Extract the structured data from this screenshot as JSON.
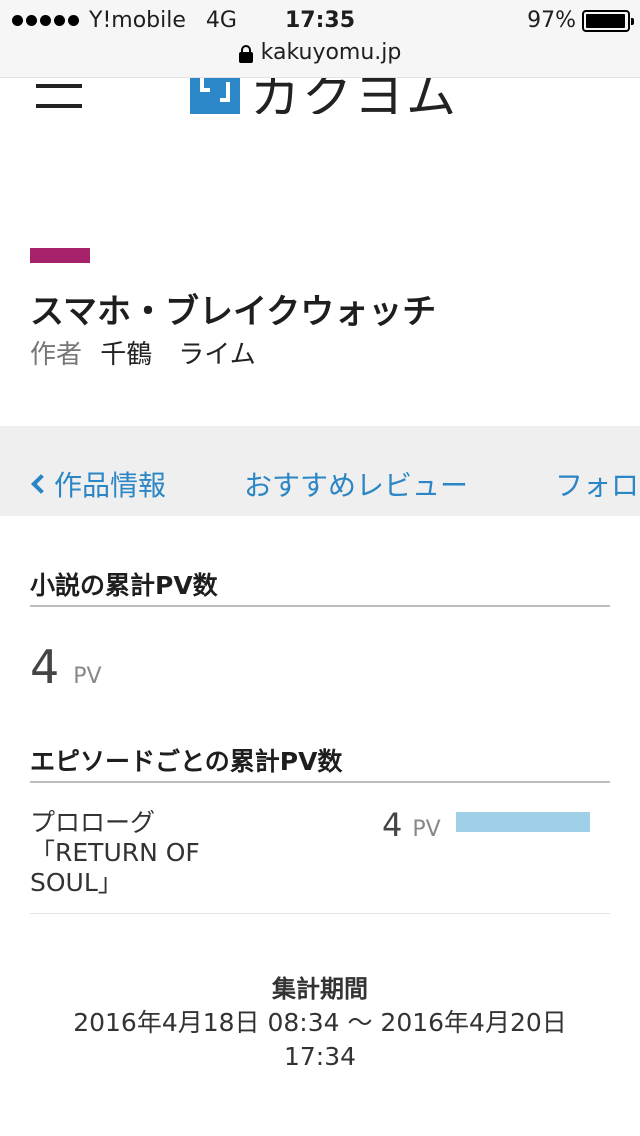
{
  "status_bar": {
    "carrier": "Y!mobile",
    "network": "4G",
    "time": "17:35",
    "battery_text": "97%",
    "battery_level": 0.97
  },
  "browser": {
    "url": "kakuyomu.jp"
  },
  "site": {
    "logo_text": "カクヨム"
  },
  "work": {
    "title": "スマホ・ブレイクウォッチ",
    "author_label": "作者",
    "author_name": "千鶴　ライム",
    "accent_color": "#a6226b"
  },
  "tabs": [
    {
      "label": "作品情報"
    },
    {
      "label": "おすすめレビュー"
    },
    {
      "label": "フォロ"
    }
  ],
  "total_section": {
    "heading": "小説の累計PV数",
    "value": "4",
    "unit": "PV"
  },
  "episode_section": {
    "heading": "エピソードごとの累計PV数",
    "episodes": [
      {
        "title_lines": [
          "プロローグ",
          "「RETURN OF",
          "SOUL」"
        ],
        "value": "4",
        "unit": "PV",
        "bar_fraction": 1.0
      }
    ]
  },
  "period": {
    "heading": "集計期間",
    "range": "2016年4月18日 08:34 〜 2016年4月20日 17:34"
  },
  "colors": {
    "link": "#2b86c5",
    "bar": "#9fd0e7",
    "logo": "#2b87c8"
  }
}
